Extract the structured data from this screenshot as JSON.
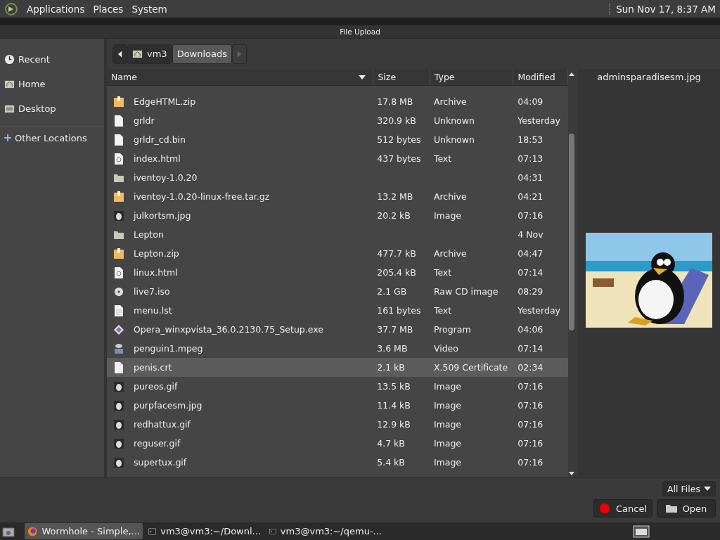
{
  "top_panel": {
    "menus": [
      "Applications",
      "Places",
      "System"
    ],
    "clock": "Sun Nov 17,  8:37 AM"
  },
  "window": {
    "title": "File Upload"
  },
  "sidebar": {
    "items": [
      {
        "label": "Recent",
        "kind": "recent",
        "selected": false
      },
      {
        "label": "Home",
        "kind": "home",
        "selected": false
      },
      {
        "label": "Desktop",
        "kind": "folder",
        "selected": false
      },
      {
        "label": "Other Locations",
        "kind": "other",
        "selected": false
      }
    ]
  },
  "path_bar": {
    "segments": [
      {
        "label": "vm3",
        "kind": "home",
        "selected": false
      },
      {
        "label": "Downloads",
        "kind": "plain",
        "selected": true
      }
    ]
  },
  "table": {
    "columns": [
      "Name",
      "Size",
      "Type",
      "Modified"
    ],
    "rows": [
      {
        "name": "EdgeHTML.zip",
        "size": "17.8 MB",
        "type": "Archive",
        "modified": "04:09",
        "kind": "archive",
        "selected": false
      },
      {
        "name": "grldr",
        "size": "320.9 kB",
        "type": "Unknown",
        "modified": "Yesterday",
        "kind": "file",
        "selected": false
      },
      {
        "name": "grldr_cd.bin",
        "size": "512 bytes",
        "type": "Unknown",
        "modified": "18:53",
        "kind": "file",
        "selected": false
      },
      {
        "name": "index.html",
        "size": "437 bytes",
        "type": "Text",
        "modified": "07:13",
        "kind": "web",
        "selected": false
      },
      {
        "name": "iventoy-1.0.20",
        "size": "",
        "type": "",
        "modified": "04:31",
        "kind": "folder",
        "selected": false
      },
      {
        "name": "iventoy-1.0.20-linux-free.tar.gz",
        "size": "13.2 MB",
        "type": "Archive",
        "modified": "04:21",
        "kind": "archive",
        "selected": false
      },
      {
        "name": "julkortsm.jpg",
        "size": "20.2 kB",
        "type": "Image",
        "modified": "07:16",
        "kind": "image",
        "selected": false
      },
      {
        "name": "Lepton",
        "size": "",
        "type": "",
        "modified": "4 Nov",
        "kind": "folder",
        "selected": false
      },
      {
        "name": "Lepton.zip",
        "size": "477.7 kB",
        "type": "Archive",
        "modified": "04:47",
        "kind": "archive",
        "selected": false
      },
      {
        "name": "linux.html",
        "size": "205.4 kB",
        "type": "Text",
        "modified": "07:14",
        "kind": "web",
        "selected": false
      },
      {
        "name": "live7.iso",
        "size": "2.1 GB",
        "type": "Raw CD image",
        "modified": "08:29",
        "kind": "disc",
        "selected": false
      },
      {
        "name": "menu.lst",
        "size": "161 bytes",
        "type": "Text",
        "modified": "Yesterday",
        "kind": "text",
        "selected": false
      },
      {
        "name": "Opera_winxpvista_36.0.2130.75_Setup.exe",
        "size": "37.7 MB",
        "type": "Program",
        "modified": "04:06",
        "kind": "program",
        "selected": false
      },
      {
        "name": "penguin1.mpeg",
        "size": "3.6 MB",
        "type": "Video",
        "modified": "07:14",
        "kind": "video",
        "selected": false
      },
      {
        "name": "penis.crt",
        "size": "2.1 kB",
        "type": "X.509 Certificate",
        "modified": "02:34",
        "kind": "file",
        "selected": true
      },
      {
        "name": "pureos.gif",
        "size": "13.5 kB",
        "type": "Image",
        "modified": "07:16",
        "kind": "image",
        "selected": false
      },
      {
        "name": "purpfacesm.jpg",
        "size": "11.4 kB",
        "type": "Image",
        "modified": "07:16",
        "kind": "image",
        "selected": false
      },
      {
        "name": "redhattux.gif",
        "size": "12.9 kB",
        "type": "Image",
        "modified": "07:16",
        "kind": "image",
        "selected": false
      },
      {
        "name": "reguser.gif",
        "size": "4.7 kB",
        "type": "Image",
        "modified": "07:16",
        "kind": "image",
        "selected": false
      },
      {
        "name": "supertux.gif",
        "size": "5.4 kB",
        "type": "Image",
        "modified": "07:16",
        "kind": "image",
        "selected": false
      }
    ]
  },
  "preview": {
    "filename": "adminsparadisesm.jpg"
  },
  "filter": {
    "value": "All Files"
  },
  "buttons": [
    {
      "label": "Cancel",
      "kind": "cancel"
    },
    {
      "label": "Open",
      "kind": "open"
    }
  ],
  "taskbar": {
    "tasks": [
      {
        "label": "Wormhole - Simple,...",
        "kind": "browser",
        "selected": true
      },
      {
        "label": "vm3@vm3:~/Downl...",
        "kind": "terminal",
        "selected": false
      },
      {
        "label": "vm3@vm3:~/qemu-...",
        "kind": "terminal",
        "selected": false
      }
    ]
  }
}
